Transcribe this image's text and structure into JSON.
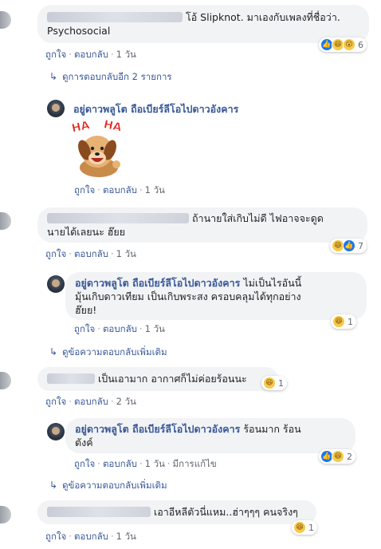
{
  "comment1": {
    "text": "โอ้ Slipknot. มาเองกับเพลงที่ชื่อว่า. Psychosocial",
    "actions": {
      "like": "ถูกใจ",
      "reply": "ตอบกลับ",
      "time": "1 วัน"
    },
    "reaction_count": "6",
    "view_replies": "ดูการตอบกลับอีก 2 รายการ"
  },
  "reply1": {
    "name": "อยู่ดาวพลูโต ถือเบียร์ลีโอไปดาวอังคาร",
    "sticker_text": "HA HA",
    "actions": {
      "like": "ถูกใจ",
      "reply": "ตอบกลับ",
      "time": "1 วัน"
    }
  },
  "comment2": {
    "text_line1": "ถ้านายใส่เกิบไม่ดี ไฟอาจจะดูด",
    "text_line2": "นายได้เลยนะ ฮ๊ยย",
    "actions": {
      "like": "ถูกใจ",
      "reply": "ตอบกลับ",
      "time": "1 วัน"
    },
    "reaction_count": "7"
  },
  "reply2": {
    "name": "อยู่ดาวพลูโต ถือเบียร์ลีโอไปดาวอังคาร",
    "text_a": "ไม่เป็นไรอันนี้",
    "text_b": "มุ้นเกิบดาวเทียม เป็นเกิบพระสง ครอบคลุมได้ทุกอย่าง",
    "text_c": "ฮ๊ยย!",
    "actions": {
      "like": "ถูกใจ",
      "reply": "ตอบกลับ",
      "time": "1 วัน"
    },
    "reaction_count": "1",
    "more_replies": "ดูข้อความตอบกลับเพิ่มเติม"
  },
  "comment3": {
    "text": "เป็นเอามาก อากาศก็ไม่ค่อยร้อนนะ",
    "actions": {
      "like": "ถูกใจ",
      "reply": "ตอบกลับ",
      "time": "2 วัน"
    },
    "reaction_count": "1"
  },
  "reply3": {
    "name": "อยู่ดาวพลูโต ถือเบียร์ลีโอไปดาวอังคาร",
    "text_a": "ร้อนมาก ร้อน",
    "text_b": "ตังค์",
    "actions": {
      "like": "ถูกใจ",
      "reply": "ตอบกลับ",
      "time": "1 วัน",
      "edited": "มีการแก้ไข"
    },
    "reaction_count": "2",
    "more_replies": "ดูข้อความตอบกลับเพิ่มเติม"
  },
  "comment4": {
    "text": "เอาอีหลีตัวนี่แหม..ฮ่าๆๆๆ คนจริงๆ",
    "actions": {
      "like": "ถูกใจ",
      "reply": "ตอบกลับ",
      "time": "1 วัน"
    },
    "reaction_count": "1"
  }
}
